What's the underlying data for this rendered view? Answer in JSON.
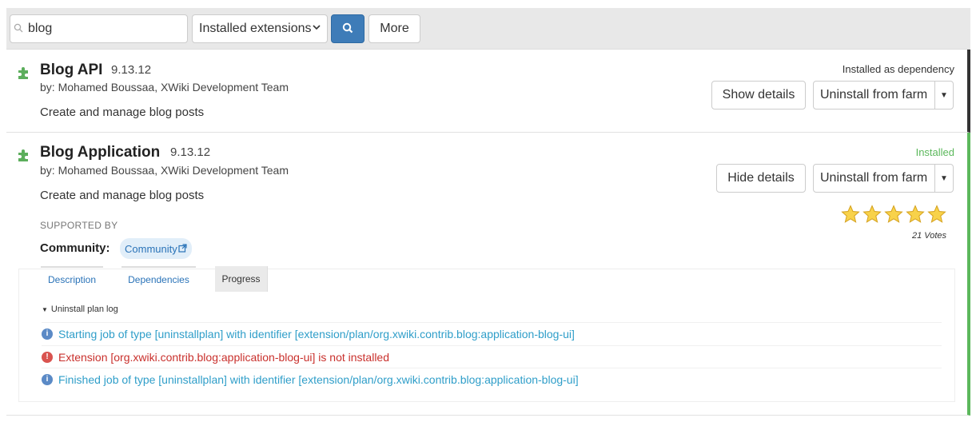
{
  "toolbar": {
    "search_value": "blog",
    "filter_selected": "Installed extensions",
    "more_label": "More"
  },
  "extensions": [
    {
      "name": "Blog API",
      "version": "9.13.12",
      "authors": "by: Mohamed Boussaa, XWiki Development Team",
      "description": "Create and manage blog posts",
      "status": "Installed as dependency",
      "details_button": "Show details",
      "uninstall_button": "Uninstall from farm"
    },
    {
      "name": "Blog Application",
      "version": "9.13.12",
      "authors": "by: Mohamed Boussaa, XWiki Development Team",
      "description": "Create and manage blog posts",
      "status": "Installed",
      "details_button": "Hide details",
      "uninstall_button": "Uninstall from farm",
      "supported_by_heading": "SUPPORTED BY",
      "community_label": "Community:",
      "community_link": "Community",
      "rating_stars": 5,
      "votes": "21 Votes",
      "tabs": [
        "Description",
        "Dependencies",
        "Progress"
      ],
      "active_tab": "Progress",
      "log_title": "Uninstall plan log",
      "log": [
        {
          "level": "info",
          "text": "Starting job of type [uninstallplan] with identifier [extension/plan/org.xwiki.contrib.blog:application-blog-ui]"
        },
        {
          "level": "error",
          "text": "Extension [org.xwiki.contrib.blog:application-blog-ui] is not installed"
        },
        {
          "level": "info",
          "text": "Finished job of type [uninstallplan] with identifier [extension/plan/org.xwiki.contrib.blog:application-blog-ui]"
        }
      ]
    }
  ],
  "colors": {
    "primary_button": "#3e7cb8",
    "installed_green": "#5cb85c",
    "link_blue": "#2a73b8",
    "log_info": "#2f9ec9",
    "log_error": "#c9302c"
  },
  "icons": {
    "search": "magnifier-icon",
    "extension": "puzzle-icon",
    "external_link": "external-link-icon",
    "star": "star-icon",
    "info": "info-icon",
    "error": "error-icon"
  }
}
